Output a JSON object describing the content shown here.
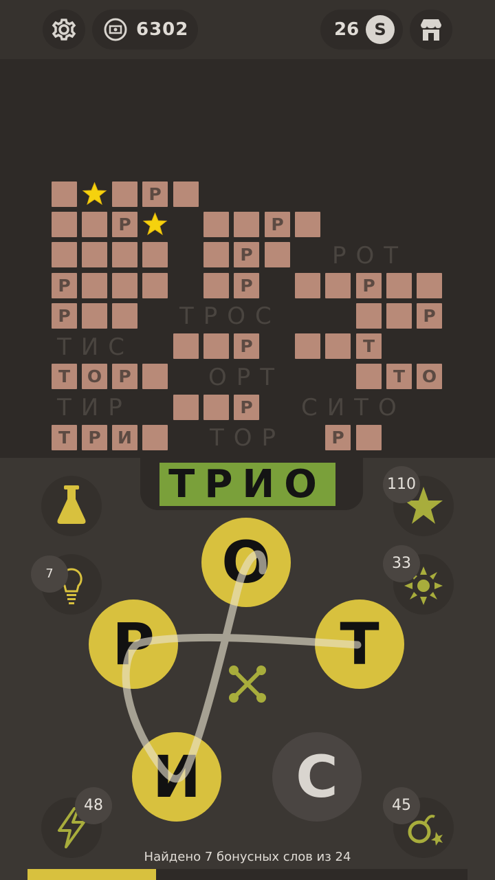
{
  "topbar": {
    "coins": "6302",
    "level": "26",
    "level_badge": "S",
    "icons": [
      "gear-icon",
      "money-icon",
      "shop-icon"
    ]
  },
  "board": {
    "grid": [
      [
        "",
        "*",
        "",
        "Р",
        ""
      ],
      [
        "",
        "",
        "Р",
        "*",
        "",
        "",
        "Р",
        ""
      ],
      [
        "",
        "",
        "",
        "",
        "",
        "Р",
        ""
      ],
      [
        "Р",
        "",
        "",
        "",
        "",
        "Р",
        "",
        "",
        "Р",
        "",
        ""
      ],
      [
        "Р",
        "",
        "",
        "",
        "",
        "Р"
      ],
      [
        "",
        "",
        "Р",
        "",
        "",
        "Т"
      ],
      [
        "Т",
        "О",
        "Р",
        "",
        "",
        "Т",
        "О"
      ],
      [
        "",
        "",
        "Р"
      ],
      [
        "Т",
        "Р",
        "И",
        "",
        "Р",
        ""
      ]
    ],
    "hidden_words": {
      "rot": "РОТ",
      "tros": "ТРОС",
      "tis": "ТИС",
      "ort": "ОРТ",
      "tir": "ТИР",
      "sito": "СИТО",
      "tor": "ТОР"
    }
  },
  "current_word": "ТРИО",
  "boosters": {
    "flask": {
      "icon": "flask-icon"
    },
    "star": {
      "icon": "star-icon",
      "count": "110"
    },
    "hint": {
      "icon": "lightbulb-icon",
      "count": "7"
    },
    "explode": {
      "icon": "burst-icon",
      "count": "33"
    },
    "lightning": {
      "icon": "lightning-icon",
      "count": "48"
    },
    "bomb": {
      "icon": "bomb-icon",
      "count": "45"
    },
    "shuffle": {
      "icon": "shuffle-icon"
    }
  },
  "wheel": {
    "letters": [
      "О",
      "Р",
      "Т",
      "И",
      "С"
    ],
    "selected": [
      "Т",
      "Р",
      "И",
      "О"
    ]
  },
  "footer": {
    "bonus_text": "Найдено 7 бонусных слов из 24",
    "found": 7,
    "total": 24
  },
  "colors": {
    "cell": "#b88a78",
    "selected_letter": "#d8c13e",
    "word_highlight": "#7aa03a",
    "star": "#f5d20e"
  }
}
